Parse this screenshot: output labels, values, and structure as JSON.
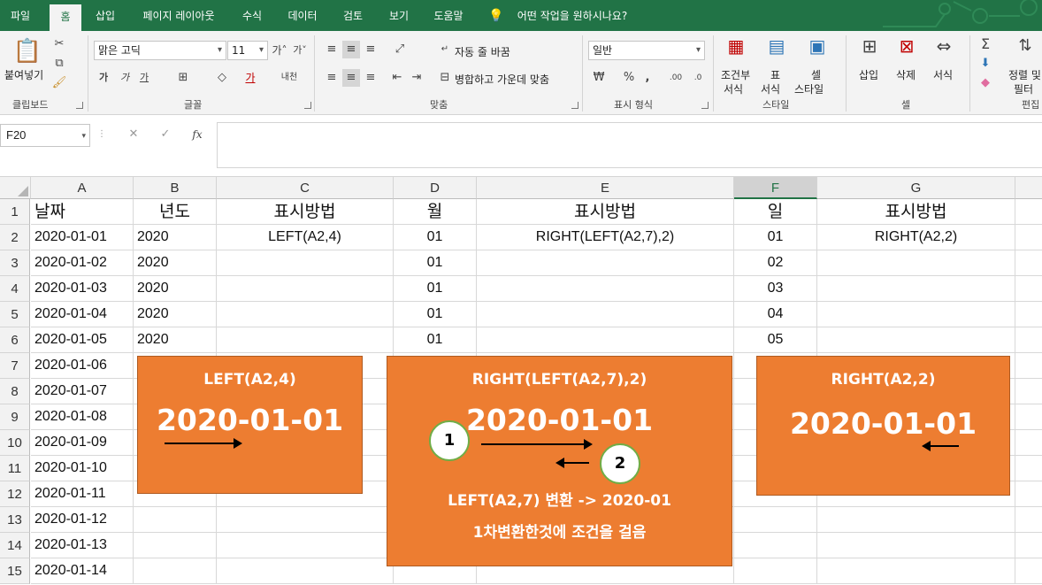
{
  "menu": {
    "tabs": [
      "파일",
      "홈",
      "삽입",
      "페이지 레이아웃",
      "수식",
      "데이터",
      "검토",
      "보기",
      "도움말"
    ],
    "tellme": "어떤 작업을 원하시나요?"
  },
  "ribbon": {
    "paste": "붙여넣기",
    "clipboard": "클립보드",
    "font_name": "맑은 고딕",
    "font_size": "11",
    "font_group": "글꼴",
    "wrap_text": "자동 줄 바꿈",
    "merge_center": "병합하고 가운데 맞춤",
    "align_group": "맞춤",
    "number_format": "일반",
    "number_group": "표시 형식",
    "cond_format": [
      "조건부",
      "서식"
    ],
    "table_format": [
      "표",
      "서식"
    ],
    "cell_style": [
      "셀",
      "스타일"
    ],
    "style_group": "스타일",
    "insert": "삽입",
    "delete": "삭제",
    "format": "서식",
    "cells_group": "셀",
    "sort_filter": [
      "정렬 및",
      "필터"
    ],
    "edit_group": "편집"
  },
  "formula_bar": {
    "name_box": "F20",
    "formula": ""
  },
  "sheet": {
    "columns": [
      "A",
      "B",
      "C",
      "D",
      "E",
      "F",
      "G"
    ],
    "selected_column": "F",
    "rows": [
      "1",
      "2",
      "3",
      "4",
      "5",
      "6",
      "7",
      "8",
      "9",
      "10",
      "11",
      "12",
      "13",
      "14",
      "15"
    ],
    "cells": [
      [
        "날짜",
        "년도",
        "표시방법",
        "월",
        "표시방법",
        "일",
        "표시방법"
      ],
      [
        "2020-01-01",
        "2020",
        "LEFT(A2,4)",
        "01",
        "RIGHT(LEFT(A2,7),2)",
        "01",
        "RIGHT(A2,2)"
      ],
      [
        "2020-01-02",
        "2020",
        "",
        "01",
        "",
        "02",
        ""
      ],
      [
        "2020-01-03",
        "2020",
        "",
        "01",
        "",
        "03",
        ""
      ],
      [
        "2020-01-04",
        "2020",
        "",
        "01",
        "",
        "04",
        ""
      ],
      [
        "2020-01-05",
        "2020",
        "",
        "01",
        "",
        "05",
        ""
      ],
      [
        "2020-01-06",
        "",
        "",
        "",
        "",
        "",
        ""
      ],
      [
        "2020-01-07",
        "",
        "",
        "",
        "",
        "",
        ""
      ],
      [
        "2020-01-08",
        "",
        "",
        "",
        "",
        "",
        ""
      ],
      [
        "2020-01-09",
        "",
        "",
        "",
        "",
        "",
        ""
      ],
      [
        "2020-01-10",
        "",
        "",
        "",
        "",
        "",
        ""
      ],
      [
        "2020-01-11",
        "",
        "",
        "",
        "",
        "",
        ""
      ],
      [
        "2020-01-12",
        "",
        "",
        "",
        "",
        "",
        ""
      ],
      [
        "2020-01-13",
        "",
        "",
        "",
        "",
        "",
        ""
      ],
      [
        "2020-01-14",
        "",
        "",
        "",
        "",
        "",
        ""
      ]
    ]
  },
  "callouts": {
    "left": {
      "formula": "LEFT(A2,4)",
      "date": "2020-01-01"
    },
    "middle": {
      "formula": "RIGHT(LEFT(A2,7),2)",
      "date": "2020-01-01",
      "step1": "1",
      "step2": "2",
      "note1": "LEFT(A2,7) 변환 -> 2020-01",
      "note2": "1차변환한것에 조건을 걸음"
    },
    "right": {
      "formula": "RIGHT(A2,2)",
      "date": "2020-01-01"
    }
  },
  "colors": {
    "accent": "#217346",
    "callout": "#ed7d31",
    "circle_border": "#70ad47"
  }
}
